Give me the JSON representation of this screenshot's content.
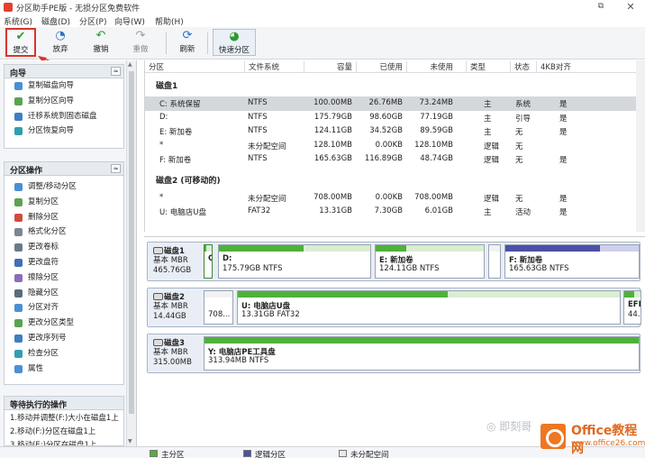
{
  "window": {
    "title": "分区助手PE版 - 无损分区免费软件",
    "restore_glyph": "⧉",
    "close_glyph": "✕"
  },
  "menu": [
    "系统(G)",
    "磁盘(D)",
    "分区(P)",
    "向导(W)",
    "帮助(H)"
  ],
  "toolbar": [
    {
      "label": "提交",
      "icon": "check-icon",
      "glyph": "✔",
      "color": "#2e9a2e"
    },
    {
      "label": "放弃",
      "icon": "discard-icon",
      "glyph": "◔",
      "color": "#2a6fc9"
    },
    {
      "label": "撤销",
      "icon": "undo-icon",
      "glyph": "↶",
      "color": "#2e9a2e"
    },
    {
      "label": "重做",
      "icon": "redo-icon",
      "glyph": "↷",
      "color": "#9aa0a6"
    },
    {
      "label": "刷新",
      "icon": "refresh-icon",
      "glyph": "⟳",
      "color": "#2a6fc9"
    },
    {
      "label": "快速分区",
      "icon": "quick-partition-icon",
      "glyph": "◕",
      "color": "#2e9a2e"
    }
  ],
  "sidebar": {
    "wizard": {
      "title": "向导",
      "items": [
        "复制磁盘向导",
        "复制分区向导",
        "迁移系统到固态磁盘",
        "分区恢复向导"
      ]
    },
    "operations": {
      "title": "分区操作",
      "items": [
        "调整/移动分区",
        "复制分区",
        "删除分区",
        "格式化分区",
        "更改卷标",
        "更改盘符",
        "擦除分区",
        "隐藏分区",
        "分区对齐",
        "更改分区类型",
        "更改序列号",
        "检查分区",
        "属性"
      ]
    },
    "pending": {
      "title": "等待执行的操作",
      "items": [
        "1.移动并调整(F:)大小在磁盘1上",
        "2.移动(F:)分区在磁盘1上",
        "3.移动(E:)分区在磁盘1上"
      ]
    },
    "collapse_glyph": "≈"
  },
  "table": {
    "columns": [
      "分区",
      "文件系统",
      "容量",
      "已使用",
      "未使用",
      "类型",
      "状态",
      "4KB对齐"
    ],
    "disks": [
      {
        "heading": "磁盘1",
        "rows": [
          {
            "partition": "C: 系统保留",
            "fs": "NTFS",
            "capacity": "100.00MB",
            "used": "26.76MB",
            "free": "73.24MB",
            "type": "主",
            "status": "系统",
            "align": "是",
            "selected": true
          },
          {
            "partition": "D:",
            "fs": "NTFS",
            "capacity": "175.79GB",
            "used": "98.60GB",
            "free": "77.19GB",
            "type": "主",
            "status": "引导",
            "align": "是"
          },
          {
            "partition": "E: 新加卷",
            "fs": "NTFS",
            "capacity": "124.11GB",
            "used": "34.52GB",
            "free": "89.59GB",
            "type": "主",
            "status": "无",
            "align": "是"
          },
          {
            "partition": "*",
            "fs": "未分配空间",
            "capacity": "128.10MB",
            "used": "0.00KB",
            "free": "128.10MB",
            "type": "逻辑",
            "status": "无",
            "align": ""
          },
          {
            "partition": "F: 新加卷",
            "fs": "NTFS",
            "capacity": "165.63GB",
            "used": "116.89GB",
            "free": "48.74GB",
            "type": "逻辑",
            "status": "无",
            "align": "是"
          }
        ]
      },
      {
        "heading": "磁盘2 (可移动的)",
        "rows": [
          {
            "partition": "*",
            "fs": "未分配空间",
            "capacity": "708.00MB",
            "used": "0.00KB",
            "free": "708.00MB",
            "type": "逻辑",
            "status": "无",
            "align": "是"
          },
          {
            "partition": "U: 电脑店U盘",
            "fs": "FAT32",
            "capacity": "13.31GB",
            "used": "7.30GB",
            "free": "6.01GB",
            "type": "主",
            "status": "活动",
            "align": "是"
          }
        ]
      }
    ]
  },
  "diskmap": [
    {
      "name": "磁盘1",
      "kind": "基本 MBR",
      "size": "465.76GB",
      "partitions": [
        {
          "name": "C",
          "size": "",
          "fill": 0.27,
          "color": "green",
          "selected": true
        },
        {
          "name": "D:",
          "size": "175.79GB NTFS",
          "fill": 0.56,
          "color": "green"
        },
        {
          "name": "E: 新加卷",
          "size": "124.11GB NTFS",
          "fill": 0.28,
          "color": "green"
        },
        {
          "name": "",
          "size": "",
          "fill": 0,
          "color": "gray"
        },
        {
          "name": "F: 新加卷",
          "size": "165.63GB NTFS",
          "fill": 0.71,
          "color": "blue"
        }
      ]
    },
    {
      "name": "磁盘2",
      "kind": "基本 MBR",
      "size": "14.44GB",
      "partitions": [
        {
          "name": "",
          "size": "708...",
          "fill": 0,
          "color": "gray"
        },
        {
          "name": "U: 电脑店U盘",
          "size": "13.31GB FAT32",
          "fill": 0.55,
          "color": "green"
        },
        {
          "name": "EFI",
          "size": "44...",
          "fill": 0.6,
          "color": "green"
        }
      ]
    },
    {
      "name": "磁盘3",
      "kind": "基本 MBR",
      "size": "315.00MB",
      "partitions": [
        {
          "name": "Y: 电脑店PE工具盘",
          "size": "313.94MB NTFS",
          "fill": 1.0,
          "color": "green"
        }
      ]
    }
  ],
  "legend": [
    {
      "label": "主分区",
      "color": "#4fb13a"
    },
    {
      "label": "逻辑分区",
      "color": "#4b4fa8"
    },
    {
      "label": "未分配空间",
      "color": "#e8e8e8"
    }
  ],
  "watermark": {
    "account": "◎ 即刻哥",
    "brand": "Office教程网",
    "url": "www.office26.com"
  }
}
